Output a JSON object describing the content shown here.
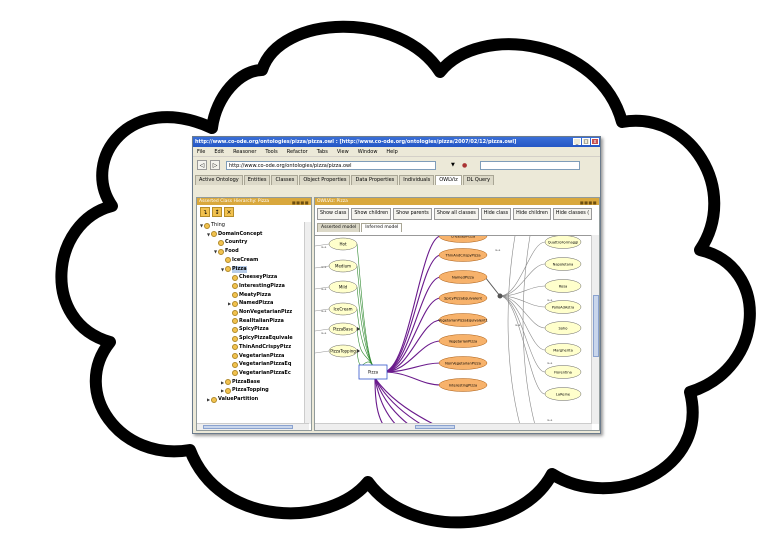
{
  "window": {
    "title": "http://www.co-ode.org/ontologies/pizza/pizza.owl : [http://www.co-ode.org/ontologies/pizza/2007/02/12/pizza.owl]",
    "buttons": {
      "minimize": "_",
      "maximize": "□",
      "close": "x"
    }
  },
  "menu": [
    "File",
    "Edit",
    "Reasoner",
    "Tools",
    "Refactor",
    "Tabs",
    "View",
    "Window",
    "Help"
  ],
  "toolbar": {
    "back_icon": "back-arrow-icon",
    "forward_icon": "forward-arrow-icon",
    "url": "http://www.co-ode.org/ontologies/pizza/pizza.owl",
    "search_placeholder": ""
  },
  "tabs": [
    "Active Ontology",
    "Entities",
    "Classes",
    "Object Properties",
    "Data Properties",
    "Individuals",
    "OWLViz",
    "DL Query"
  ],
  "active_tab": "OWLViz",
  "left_panel": {
    "header": "Asserted Class Hierarchy: Pizza",
    "tree": [
      {
        "label": "Thing",
        "depth": 0,
        "toggle": "▼",
        "bold": false
      },
      {
        "label": "DomainConcept",
        "depth": 1,
        "toggle": "▼",
        "bold": true
      },
      {
        "label": "Country",
        "depth": 2,
        "toggle": "",
        "bold": true
      },
      {
        "label": "Food",
        "depth": 2,
        "toggle": "▼",
        "bold": true
      },
      {
        "label": "IceCream",
        "depth": 3,
        "toggle": "",
        "bold": true
      },
      {
        "label": "Pizza",
        "depth": 3,
        "toggle": "▼",
        "bold": true,
        "selected": true
      },
      {
        "label": "CheeseyPizza",
        "depth": 4,
        "toggle": "",
        "bold": true
      },
      {
        "label": "InterestingPizza",
        "depth": 4,
        "toggle": "",
        "bold": true
      },
      {
        "label": "MeatyPizza",
        "depth": 4,
        "toggle": "",
        "bold": true
      },
      {
        "label": "NamedPizza",
        "depth": 4,
        "toggle": "▶",
        "bold": true
      },
      {
        "label": "NonVegetarianPizz",
        "depth": 4,
        "toggle": "",
        "bold": true
      },
      {
        "label": "RealItalianPizza",
        "depth": 4,
        "toggle": "",
        "bold": true
      },
      {
        "label": "SpicyPizza",
        "depth": 4,
        "toggle": "",
        "bold": true
      },
      {
        "label": "SpicyPizzaEquivale",
        "depth": 4,
        "toggle": "",
        "bold": true
      },
      {
        "label": "ThinAndCrispyPizz",
        "depth": 4,
        "toggle": "",
        "bold": true
      },
      {
        "label": "VegetarianPizza",
        "depth": 4,
        "toggle": "",
        "bold": true
      },
      {
        "label": "VegetarianPizzaEq",
        "depth": 4,
        "toggle": "",
        "bold": true
      },
      {
        "label": "VegetarianPizzaEc",
        "depth": 4,
        "toggle": "",
        "bold": true
      },
      {
        "label": "PizzaBase",
        "depth": 3,
        "toggle": "▶",
        "bold": true
      },
      {
        "label": "PizzaTopping",
        "depth": 3,
        "toggle": "▶",
        "bold": true
      },
      {
        "label": "ValuePartition",
        "depth": 1,
        "toggle": "▶",
        "bold": true
      }
    ]
  },
  "right_panel": {
    "header": "OWLViz: Pizza",
    "buttons": [
      "Show class",
      "Show children",
      "Show parents",
      "Show all classes",
      "Hide class",
      "Hide children",
      "Hide classes ("
    ],
    "model_tabs": [
      "Asserted model",
      "Inferred model"
    ],
    "active_model_tab": "Inferred model",
    "graph": {
      "left_nodes": [
        "Hot",
        "Medium",
        "Mild",
        "IceCream",
        "PizzaBase",
        "PizzaTopping"
      ],
      "center_node": "Pizza",
      "middle_nodes": [
        "CheeseyPizza",
        "ThinAndCrispyPizza",
        "NamedPizza",
        "SpicyPizzaEquivalent",
        "VegetarianPizzaEquivalent1",
        "VegetarianPizza",
        "NonVegetarianPizza",
        "InterestingPizza"
      ],
      "right_nodes": [
        "QuattroFormaggi",
        "Napoletana",
        "Rosa",
        "PolloAdAstra",
        "Soho",
        "Margherita",
        "Fiorentina",
        "LaReine"
      ],
      "edge_label": "is-a"
    }
  },
  "colors": {
    "panel_header": "#d9a83d",
    "node_fill": "#ffffcc",
    "inferred_node_fill": "#f7b26b",
    "edge_purple": "#6a1a8c",
    "edge_green": "#2f8a2f",
    "edge_gray": "#8a8a8a"
  }
}
